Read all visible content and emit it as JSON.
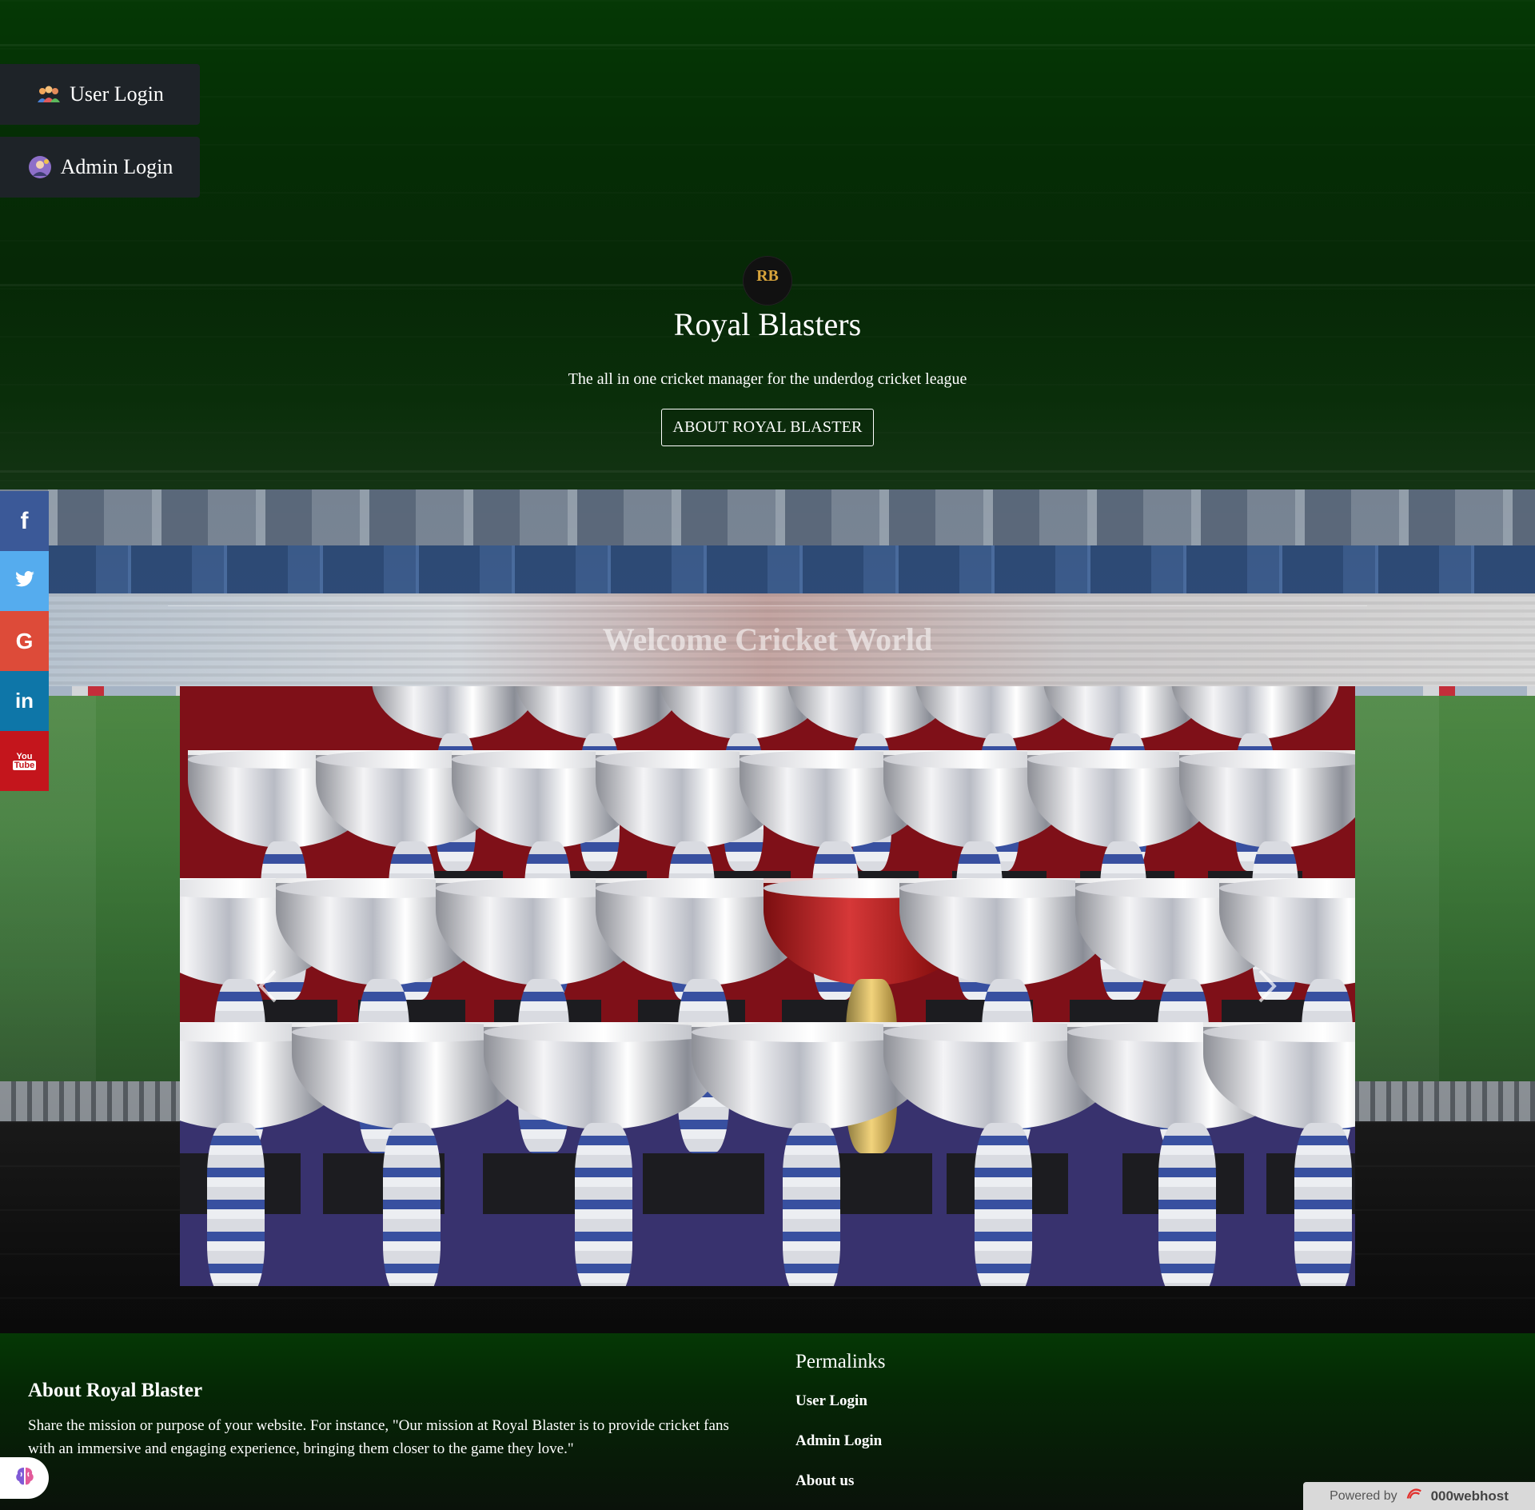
{
  "login": {
    "user_label": "User Login",
    "admin_label": "Admin Login"
  },
  "hero": {
    "logo_text": "RB",
    "title": "Royal Blasters",
    "subtitle": "The all in one cricket manager for the underdog cricket league",
    "about_button": "ABOUT ROYAL BLASTER"
  },
  "social": {
    "items": [
      {
        "name": "facebook-icon",
        "glyph": "f",
        "color": "#3b5998"
      },
      {
        "name": "twitter-icon",
        "glyph": "twitter",
        "color": "#55acee"
      },
      {
        "name": "google-icon",
        "glyph": "G",
        "color": "#dd4b39"
      },
      {
        "name": "linkedin-icon",
        "glyph": "in",
        "color": "#0e76a8"
      },
      {
        "name": "youtube-icon",
        "glyph": "You Tube",
        "color": "#c4151c"
      }
    ]
  },
  "welcome": {
    "heading": "Welcome Cricket World"
  },
  "carousel": {
    "image": "trophies-photo"
  },
  "footer": {
    "about_heading": "About Royal Blaster",
    "about_text": "Share the mission or purpose of your website. For instance, \"Our mission at Royal Blaster is to provide cricket fans with an immersive and engaging experience, bringing them closer to the game they love.\"",
    "permalinks_heading": "Permalinks",
    "links": [
      "User Login",
      "Admin Login",
      "About us"
    ]
  },
  "powered_by": {
    "prefix": "Powered by",
    "brand": "000webhost"
  },
  "colors": {
    "top_green": "#053805",
    "button_dark": "#1e2328",
    "facebook": "#3b5998",
    "twitter": "#55acee",
    "google": "#dd4b39",
    "linkedin": "#0e76a8",
    "youtube": "#c4151c"
  }
}
